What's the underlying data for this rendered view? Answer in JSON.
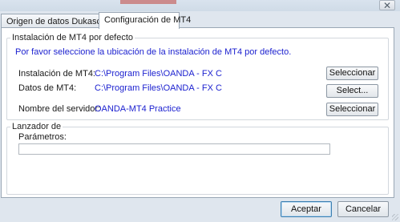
{
  "window": {
    "close_glyph": "✕"
  },
  "tabs": [
    {
      "label": "Origen de datos Dukascopy"
    },
    {
      "label": "Configuración de MT4"
    }
  ],
  "default_install": {
    "group_title": "Instalación de MT4 por defecto",
    "hint": "Por favor seleccione la ubicación de la instalación de MT4 por defecto.",
    "rows": [
      {
        "label": "Instalación de MT4:",
        "value": "C:\\Program Files\\OANDA - FX C",
        "button": "Seleccionar"
      },
      {
        "label": "Datos de MT4:",
        "value": "C:\\Program Files\\OANDA - FX C",
        "button": "Select..."
      },
      {
        "label": "Nombre del servidor:",
        "value": "OANDA-MT4 Practice",
        "button": "Seleccionar"
      }
    ]
  },
  "launcher": {
    "group_title": "Lanzador de",
    "params_label": "Parámetros:",
    "params_value": ""
  },
  "footer": {
    "accept": "Aceptar",
    "cancel": "Cancelar"
  },
  "colors": {
    "link_blue": "#1a1fcf",
    "panel_bg": "#ffffff",
    "window_bg": "#dfe6ee"
  }
}
